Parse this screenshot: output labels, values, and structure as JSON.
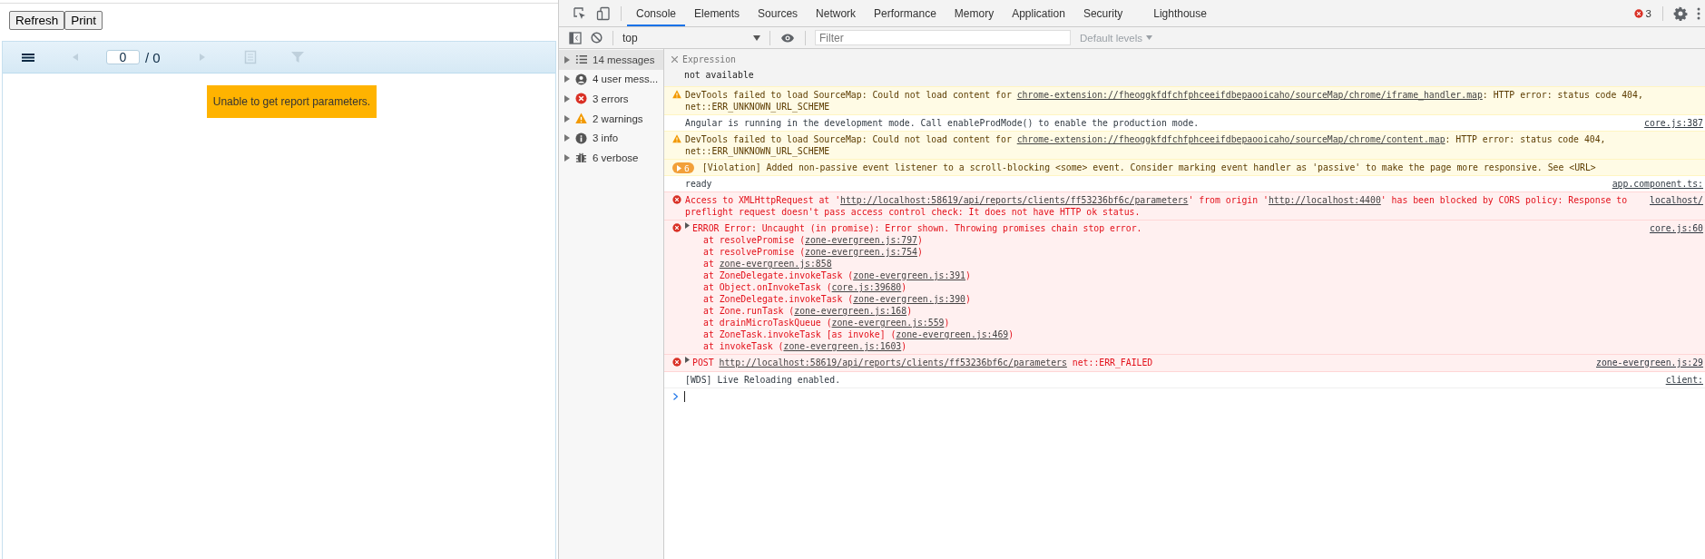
{
  "report_app": {
    "buttons": [
      "Refresh",
      "Print"
    ],
    "viewer_toolbar": [
      {
        "kind": "menu",
        "disabled": false
      },
      {
        "kind": "prev",
        "disabled": true
      },
      {
        "kind": "page",
        "value": "0",
        "total": "/ 0"
      },
      {
        "kind": "next",
        "disabled": true
      },
      {
        "kind": "document",
        "disabled": true
      },
      {
        "kind": "filter",
        "disabled": true
      }
    ],
    "message": "Unable to get report parameters."
  },
  "devtools": {
    "tabs": [
      {
        "label": "Console",
        "selected": true
      },
      {
        "label": "Elements",
        "selected": false
      },
      {
        "label": "Sources",
        "selected": false
      },
      {
        "label": "Network",
        "selected": false
      },
      {
        "label": "Performance",
        "selected": false
      },
      {
        "label": "Memory",
        "selected": false
      },
      {
        "label": "Application",
        "selected": false
      },
      {
        "label": "Security",
        "selected": false
      },
      {
        "label": "Lighthouse",
        "selected": false
      }
    ],
    "error_count": "3",
    "context": "top",
    "filter_placeholder": "Filter",
    "levels": "Default levels",
    "sidebar": [
      {
        "kind": "messages",
        "label": "14 messages",
        "selected": true
      },
      {
        "kind": "user",
        "label": "4 user mess...",
        "selected": false
      },
      {
        "kind": "error",
        "label": "3 errors",
        "selected": false
      },
      {
        "kind": "warning",
        "label": "2 warnings",
        "selected": false
      },
      {
        "kind": "info",
        "label": "3 info",
        "selected": false
      },
      {
        "kind": "verbose",
        "label": "6 verbose",
        "selected": false
      }
    ],
    "expression": {
      "label": "Expression",
      "value": "not available"
    },
    "messages": [
      {
        "kind": "warning",
        "lines": [
          [
            "DevTools failed to load SourceMap: Could not load content for ",
            {
              "link": "chrome-extension://fheoggkfdfchfphceeifdbepaooicaho/sourceMap/chrome/iframe_handler.map"
            },
            ": HTTP error: status code 404,"
          ],
          [
            "net::ERR_UNKNOWN_URL_SCHEME"
          ]
        ]
      },
      {
        "kind": "info",
        "lines": [
          [
            "Angular is running in the development mode. Call enableProdMode() to enable the production mode."
          ]
        ],
        "source": "core.js:387"
      },
      {
        "kind": "warning",
        "lines": [
          [
            "DevTools failed to load SourceMap: Could not load content for ",
            {
              "link": "chrome-extension://fheoggkfdfchfphceeifdbepaooicaho/sourceMap/chrome/content.map"
            },
            ": HTTP error: status code 404,"
          ],
          [
            "net::ERR_UNKNOWN_URL_SCHEME"
          ]
        ]
      },
      {
        "kind": "violation",
        "count": "6",
        "lines": [
          [
            "[Violation] Added non-passive event listener to a scroll-blocking <some> event. Consider marking event handler as 'passive' to make the page more responsive. See <URL>"
          ]
        ]
      },
      {
        "kind": "info",
        "lines": [
          [
            "ready"
          ]
        ],
        "source": "app.component.ts:"
      },
      {
        "kind": "error",
        "lines": [
          [
            "Access to XMLHttpRequest at '",
            {
              "link": "http://localhost:58619/api/reports/clients/ff53236bf6c/parameters"
            },
            "' from origin '",
            {
              "link": "http://localhost:4400"
            },
            "' has been blocked by CORS policy: Response to"
          ],
          [
            "preflight request doesn't pass access control check: It does not have HTTP ok status."
          ]
        ],
        "source": "localhost/"
      },
      {
        "kind": "error",
        "expandable": true,
        "lines": [
          [
            "ERROR Error: Uncaught (in promise): Error shown. Throwing promises chain stop error."
          ]
        ],
        "source": "core.js:60",
        "stack": [
          [
            "at resolvePromise (",
            {
              "link": "zone-evergreen.js:797"
            },
            ")"
          ],
          [
            "at resolvePromise (",
            {
              "link": "zone-evergreen.js:754"
            },
            ")"
          ],
          [
            "at ",
            {
              "link": "zone-evergreen.js:858"
            }
          ],
          [
            "at ZoneDelegate.invokeTask (",
            {
              "link": "zone-evergreen.js:391"
            },
            ")"
          ],
          [
            "at Object.onInvokeTask (",
            {
              "link": "core.js:39680"
            },
            ")"
          ],
          [
            "at ZoneDelegate.invokeTask (",
            {
              "link": "zone-evergreen.js:390"
            },
            ")"
          ],
          [
            "at Zone.runTask (",
            {
              "link": "zone-evergreen.js:168"
            },
            ")"
          ],
          [
            "at drainMicroTaskQueue (",
            {
              "link": "zone-evergreen.js:559"
            },
            ")"
          ],
          [
            "at ZoneTask.invokeTask [as invoke] (",
            {
              "link": "zone-evergreen.js:469"
            },
            ")"
          ],
          [
            "at invokeTask (",
            {
              "link": "zone-evergreen.js:1603"
            },
            ")"
          ]
        ]
      },
      {
        "kind": "error",
        "expandable": true,
        "lines": [
          [
            "POST ",
            {
              "link": "http://localhost:58619/api/reports/clients/ff53236bf6c/parameters"
            },
            " net::ERR_FAILED"
          ]
        ],
        "source": "zone-evergreen.js:29"
      },
      {
        "kind": "info",
        "lines": [
          [
            "[WDS] Live Reloading enabled."
          ]
        ],
        "source": "client:"
      }
    ]
  }
}
